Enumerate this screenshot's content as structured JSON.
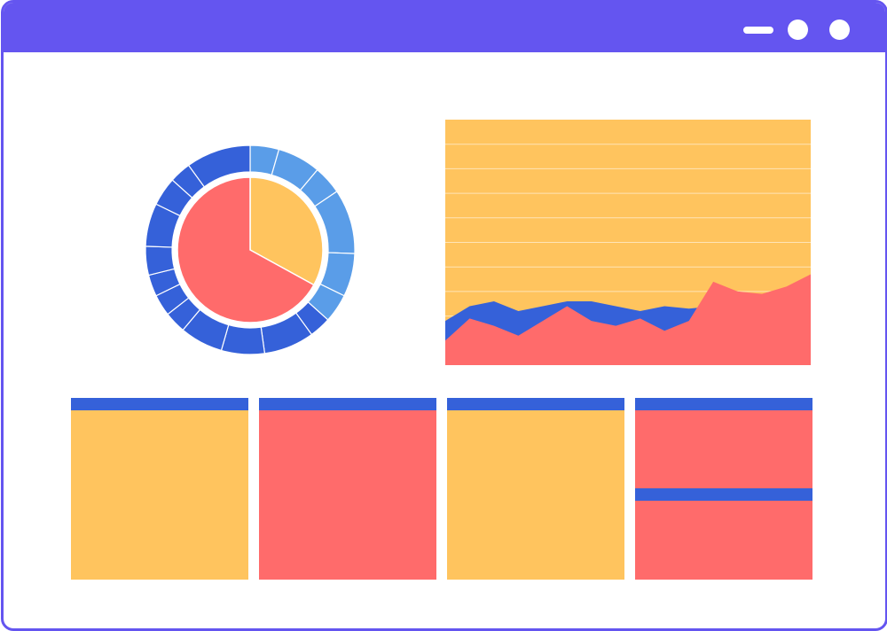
{
  "window": {
    "frame_color": "#6455f0",
    "controls": [
      "minimize-icon",
      "maximize-icon",
      "close-icon"
    ]
  },
  "colors": {
    "yellow": "#ffc45e",
    "red": "#ff6b6b",
    "blue": "#3561d9",
    "light_blue": "#5a9de8"
  },
  "chart_data": [
    {
      "type": "pie",
      "title": "",
      "inner": [
        {
          "value": 33,
          "color": "#ffc45e"
        },
        {
          "value": 67,
          "color": "#ff6b6b"
        }
      ],
      "outer_ring": [
        {
          "value": 4,
          "color": "#5a9de8"
        },
        {
          "value": 6,
          "color": "#5a9de8"
        },
        {
          "value": 4,
          "color": "#5a9de8"
        },
        {
          "value": 9,
          "color": "#5a9de8"
        },
        {
          "value": 6,
          "color": "#5a9de8"
        },
        {
          "value": 4,
          "color": "#5a9de8"
        },
        {
          "value": 3,
          "color": "#3561d9"
        },
        {
          "value": 7,
          "color": "#3561d9"
        },
        {
          "value": 6,
          "color": "#3561d9"
        },
        {
          "value": 6,
          "color": "#3561d9"
        },
        {
          "value": 3,
          "color": "#3561d9"
        },
        {
          "value": 3,
          "color": "#3561d9"
        },
        {
          "value": 3,
          "color": "#3561d9"
        },
        {
          "value": 4,
          "color": "#3561d9"
        },
        {
          "value": 6,
          "color": "#3561d9"
        },
        {
          "value": 4,
          "color": "#3561d9"
        },
        {
          "value": 3,
          "color": "#3561d9"
        },
        {
          "value": 9,
          "color": "#3561d9"
        }
      ]
    },
    {
      "type": "area",
      "title": "",
      "xlabel": "",
      "ylabel": "",
      "grid": true,
      "ylim": [
        0,
        10
      ],
      "x": [
        0,
        1,
        2,
        3,
        4,
        5,
        6,
        7,
        8,
        9,
        10,
        11,
        12,
        13,
        14,
        15
      ],
      "series": [
        {
          "values": [
            1.8,
            2.4,
            2.6,
            2.2,
            2.4,
            2.6,
            2.6,
            2.4,
            2.2,
            2.4,
            2.3,
            2.4,
            3.0,
            2.8,
            2.8,
            2.7
          ],
          "color": "#3561d9"
        },
        {
          "values": [
            1.0,
            1.9,
            1.6,
            1.2,
            1.8,
            2.4,
            1.8,
            1.6,
            1.9,
            1.4,
            1.8,
            3.4,
            3.0,
            2.9,
            3.2,
            3.7
          ],
          "color": "#ff6b6b"
        }
      ],
      "background": "#ffc45e",
      "grid_lines": 10
    }
  ],
  "cards": [
    {
      "header_color": "#3561d9",
      "body_color": "#ffc45e"
    },
    {
      "header_color": "#3561d9",
      "body_color": "#ff6b6b"
    },
    {
      "header_color": "#3561d9",
      "body_color": "#ffc45e"
    },
    {
      "header_color": "#3561d9",
      "body_color": "#ff6b6b"
    },
    {
      "header_color": "#3561d9",
      "body_color": "#ff6b6b"
    }
  ]
}
